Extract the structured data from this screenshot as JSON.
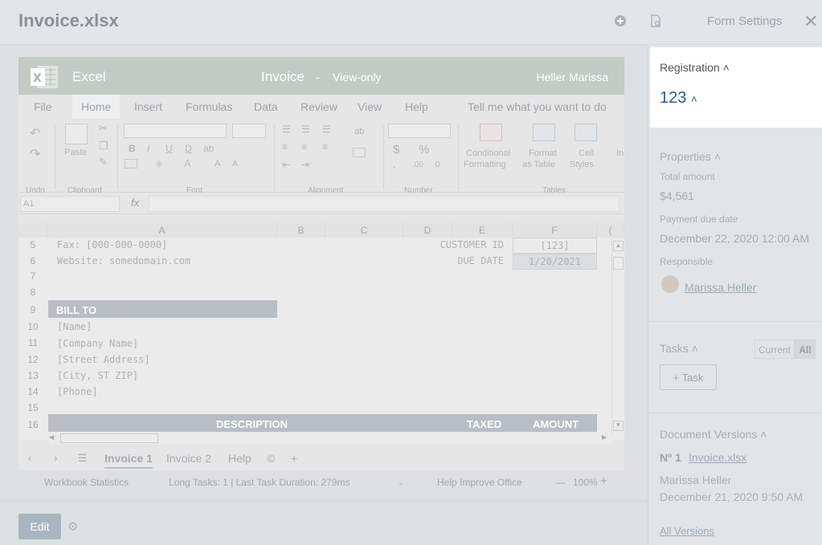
{
  "header": {
    "title": "Invoice.xlsx",
    "form_settings": "Form Settings"
  },
  "excel": {
    "app": "Excel",
    "doc": "Invoice",
    "sep": "-",
    "mode": "View-only",
    "user": "Heller Marissa",
    "menu": [
      "File",
      "Home",
      "Insert",
      "Formulas",
      "Data",
      "Review",
      "View",
      "Help",
      "Tell me what you want to do"
    ],
    "ribbon": {
      "undo": "Undo",
      "clipboard": "Clipboard",
      "paste": "Paste",
      "font": "Font",
      "alignment": "Alignment",
      "number": "Number",
      "tables": "Tables",
      "cond1": "Conditional",
      "cond2": "Formatting",
      "fmt1": "Format",
      "fmt2": "as Table",
      "cell1": "Cell",
      "cell2": "Styles",
      "ins": "In",
      "currency": "$",
      "pct": "%",
      "fx": "fx",
      "namebox": "A1"
    },
    "columns": [
      "A",
      "B",
      "C",
      "D",
      "E",
      "F",
      "("
    ],
    "rows": [
      "5",
      "6",
      "7",
      "8",
      "9",
      "10",
      "11",
      "12",
      "13",
      "14",
      "15",
      "16"
    ],
    "cells": {
      "fax": "Fax: [000-000-0000]",
      "website": "Website: somedomain.com",
      "cust_label": "CUSTOMER ID",
      "cust_val": "[123]",
      "due_label": "DUE DATE",
      "due_val": "1/20/2021",
      "bill_to": "BILL TO",
      "name": "[Name]",
      "company": "[Company Name]",
      "street": "[Street Address]",
      "city": "[City, ST  ZIP]",
      "phone": "[Phone]",
      "desc": "DESCRIPTION",
      "taxed": "TAXED",
      "amount": "AMOUNT"
    },
    "sheet_tabs": [
      "Invoice 1",
      "Invoice 2",
      "Help",
      "©"
    ],
    "status": {
      "stats": "Workbook Statistics",
      "tasks": "Long Tasks: 1 | Last Task Duration: 279ms",
      "help": "Help Improve Office",
      "zoom": "100%"
    }
  },
  "edit_label": "Edit",
  "sidebar": {
    "registration": "Registration",
    "reg_value": "123",
    "properties": "Properties",
    "total_label": "Total amount",
    "total_value": "$4,561",
    "due_label": "Payment due date",
    "due_value": "December 22, 2020 12:00 AM",
    "resp_label": "Responsible",
    "resp_name": "Marissa Heller",
    "tasks": "Tasks",
    "current": "Current",
    "all": "All",
    "add_task": "+ Task",
    "versions": "Document Versions",
    "ver_num": "Nº 1",
    "ver_file": "Invoice.xlsx",
    "ver_author": "Marissa Heller",
    "ver_date": "December 21, 2020 9:50 AM",
    "all_versions": "All Versions"
  }
}
